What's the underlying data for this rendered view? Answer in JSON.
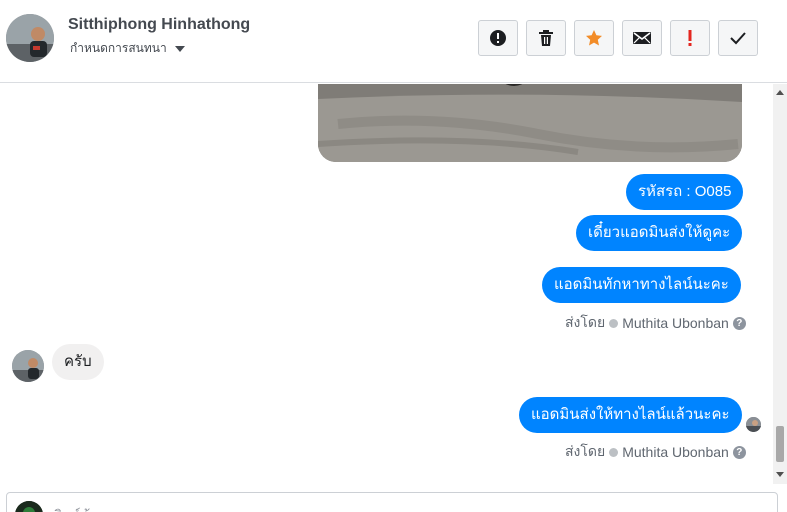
{
  "header": {
    "contact_name": "Sitthiphong Hinhathong",
    "settings_label": "กำหนดการสนทนา"
  },
  "toolbar": {
    "buttons": [
      {
        "name": "mark-spam",
        "icon": "alert-circle-icon"
      },
      {
        "name": "delete",
        "icon": "trash-icon"
      },
      {
        "name": "star",
        "icon": "star-icon"
      },
      {
        "name": "mark-unread",
        "icon": "envelope-icon"
      },
      {
        "name": "important",
        "icon": "exclamation-icon"
      },
      {
        "name": "mark-done",
        "icon": "check-icon"
      }
    ]
  },
  "messages": [
    {
      "id": "m1",
      "direction": "out",
      "text": "รหัสรถ : O085"
    },
    {
      "id": "m2",
      "direction": "out",
      "text": "เดี๋ยวแอดมินส่งให้ดูคะ"
    },
    {
      "id": "m3",
      "direction": "out",
      "text": "แอดมินทักหาทางไลน์นะคะ"
    },
    {
      "id": "m4",
      "direction": "in",
      "text": "ครับ"
    },
    {
      "id": "m5",
      "direction": "out",
      "text": "แอดมินส่งให้ทางไลน์แล้วนะคะ"
    }
  ],
  "sent_by": {
    "prefix": "ส่งโดย",
    "agent": "Muthita Ubonban",
    "help": "?"
  },
  "composer": {
    "placeholder": "พิมพ์ข้อความ..."
  },
  "colors": {
    "outgoing_bubble": "#0084ff",
    "incoming_bubble": "#f1f0f0",
    "star": "#f28c28",
    "important": "#e4261f"
  }
}
